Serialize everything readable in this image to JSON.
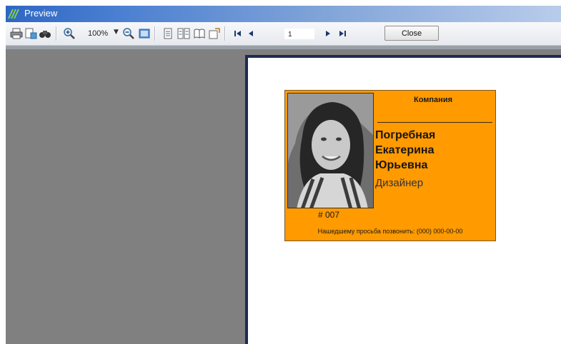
{
  "window": {
    "title": "Preview"
  },
  "toolbar": {
    "icons": [
      "print-icon",
      "page-setup-icon",
      "find-icon",
      "zoom-in-icon",
      "zoom-out-icon",
      "whole-page-icon",
      "single-page-icon",
      "multiple-pages-icon",
      "book-icon",
      "export-icon",
      "first-page-icon",
      "previous-page-icon",
      "next-page-icon",
      "last-page-icon"
    ],
    "zoom": "100%",
    "page_number": "1",
    "close_label": "Close"
  },
  "badge": {
    "company": "Компания",
    "name_line1": "Погребная",
    "name_line2": "Екатерина",
    "name_line3": "Юрьевна",
    "role": "Дизайнер",
    "number": "# 007",
    "call_note": "Нашедшему просьба позвонить: (000) 000-00-00",
    "background_color": "#ff9a00"
  },
  "colors": {
    "titlebar": "#2f66c4",
    "viewport_background": "#808080",
    "page_border": "#1d2b55"
  }
}
